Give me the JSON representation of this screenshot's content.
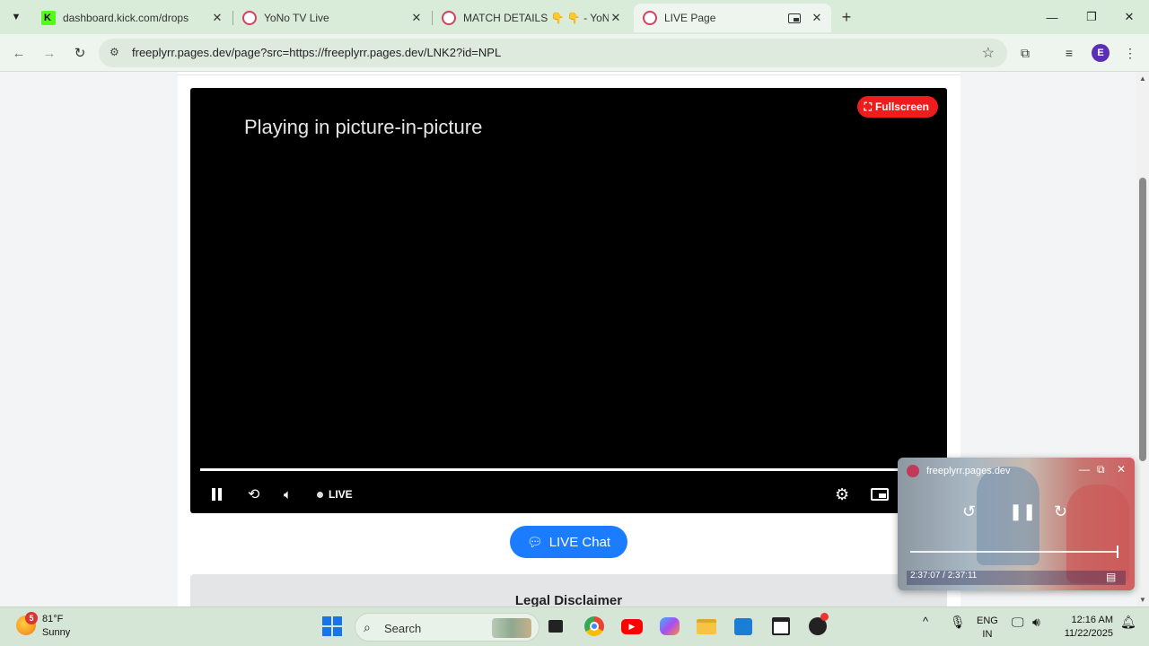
{
  "browser": {
    "tabs": [
      {
        "title": "dashboard.kick.com/drops",
        "favicon": "kick-icon",
        "active": false
      },
      {
        "title": "YoNo TV Live",
        "favicon": "yono-icon",
        "active": false
      },
      {
        "title": "MATCH DETAILS 👇 👇 - YoNo",
        "favicon": "yono-icon",
        "active": false
      },
      {
        "title": "LIVE Page",
        "favicon": "yono-icon",
        "active": true
      }
    ],
    "url": "freeplyrr.pages.dev/page?src=https://freeplyrr.pages.dev/LNK2?id=NPL",
    "profile_initial": "E",
    "colors": {
      "tab_strip": "#d9ebd9",
      "toolbar": "#eef5ee",
      "profile": "#5b2fb5"
    }
  },
  "page": {
    "player": {
      "pip_message": "Playing in picture-in-picture",
      "fullscreen_label": "Fullscreen",
      "live_label": "LIVE",
      "progress": 1.0
    },
    "live_chat_label": "LIVE Chat",
    "disclaimer_title": "Legal Disclaimer",
    "colors": {
      "fullscreen_button": "#ee1c1c",
      "chat_button": "#1b7cff"
    }
  },
  "pip_window": {
    "site": "freeplyrr.pages.dev",
    "time": "2:37:07 / 2:37:11"
  },
  "taskbar": {
    "weather": {
      "badge": "5",
      "temp": "81°F",
      "condition": "Sunny"
    },
    "search_label": "Search",
    "language": {
      "line1": "ENG",
      "line2": "IN"
    },
    "clock": {
      "time": "12:16 AM",
      "date": "11/22/2025"
    }
  }
}
